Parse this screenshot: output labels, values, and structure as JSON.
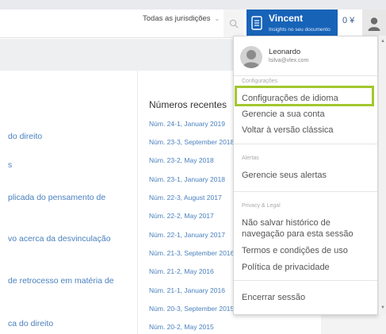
{
  "header": {
    "jurisdictions_label": "Todas as jurisdições",
    "vincent_title": "Vincent",
    "vincent_subtitle": "Insights no seu documento",
    "credits": "0 ¥"
  },
  "left_items": [
    "do direito",
    "s",
    "plicada do pensamento de",
    "vo acerca da desvinculação",
    "de retrocesso em matéria de",
    "ca do direito"
  ],
  "recent": {
    "heading": "Números recentes",
    "items": [
      "Núm. 24-1, January 2019",
      "Núm. 23-3, September 2018",
      "Núm. 23-2, May 2018",
      "Núm. 23-1, January 2018",
      "Núm. 22-3, August 2017",
      "Núm. 22-2, May 2017",
      "Núm. 22-1, January 2017",
      "Núm. 21-3, September 2016",
      "Núm. 21-2, May 2016",
      "Núm. 21-1, January 2016",
      "Núm. 20-3, September 2015",
      "Núm. 20-2, May 2015"
    ]
  },
  "dropdown": {
    "user_name": "Leonardo",
    "user_email": "lsilva@vlex.com",
    "settings_title": "Configurações",
    "settings_items": [
      "Configurações de idioma",
      "Gerencie a sua conta",
      "Voltar à versão clássica"
    ],
    "alerts_title": "Alertas",
    "alerts_items": [
      "Gerencie seus alertas"
    ],
    "privacy_title": "Privacy & Legal",
    "privacy_items": [
      "Não salvar histórico de navegação para esta sessão",
      "Termos e condições de uso",
      "Política de privacidade"
    ],
    "logout": "Encerrar sessão"
  },
  "colors": {
    "accent_blue": "#1763b8",
    "link_blue": "#4a80be",
    "highlight_green": "#a2c82e"
  }
}
